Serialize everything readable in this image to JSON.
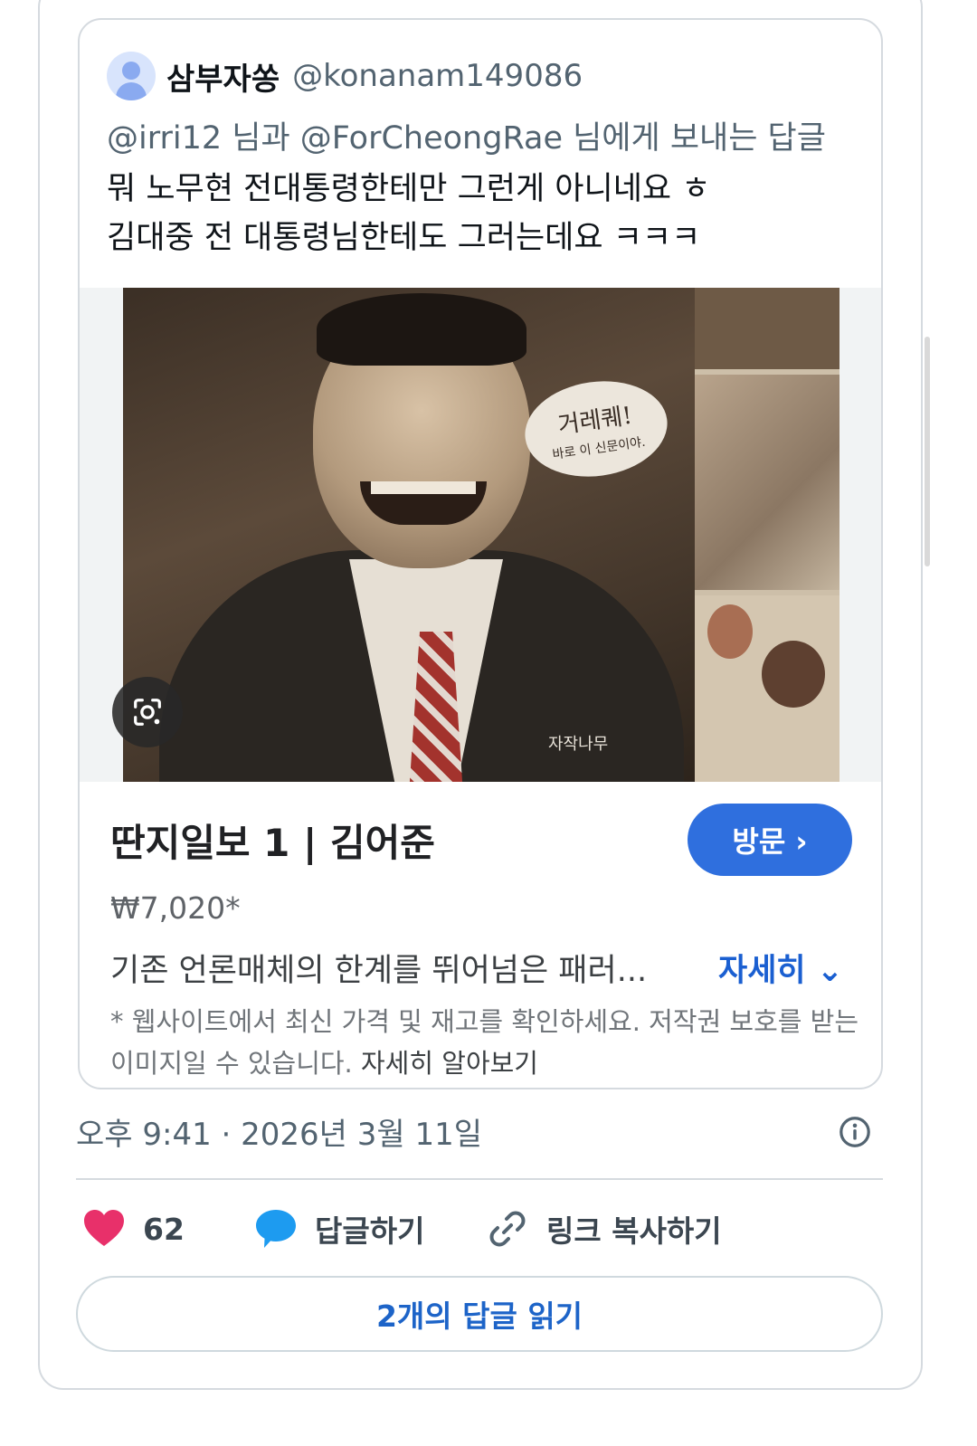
{
  "quoted_post": {
    "author_name": "삼부자쏭",
    "author_handle": "@konanam149086",
    "reply_to": "@irri12 님과 @ForCheongRae 님에게 보내는 답글",
    "text_line1": "뭐 노무현 전대통령한테만 그런게 아니네요 ㅎ",
    "text_line2": "김대중 전 대통령님한테도 그러는데요 ㅋㅋㅋ"
  },
  "image": {
    "speech_bubble_line1": "거레퀘!",
    "speech_bubble_line2": "바로 이 신문이야.",
    "publisher_mark": "자작나무"
  },
  "product": {
    "title": "딴지일보 1 | 김어준",
    "price": "₩7,020*",
    "description": "기존 언론매체의 한계를 뛰어넘은 패러...",
    "more_label": "자세히 ⌄",
    "visit_label": "방문 ›",
    "disclaimer": "* 웹사이트에서 최신 가격 및 재고를 확인하세요. 저작권 보호를 받는 이미지일 수 있습니다.",
    "learn_more": "자세히 알아보기"
  },
  "post_meta": {
    "timestamp": "오후 9:41 · 2026년 3월 11일"
  },
  "actions": {
    "like_count": "62",
    "reply_label": "답글하기",
    "copy_link_label": "링크 복사하기"
  },
  "read_replies_label": "2개의 답글 읽기",
  "colors": {
    "accent_blue": "#2f6fde",
    "like_pink": "#e8306a",
    "reply_blue": "#1d9bf0"
  },
  "icons": [
    "avatar-placeholder-icon",
    "google-lens-icon",
    "info-icon",
    "heart-icon",
    "reply-bubble-icon",
    "link-icon"
  ]
}
